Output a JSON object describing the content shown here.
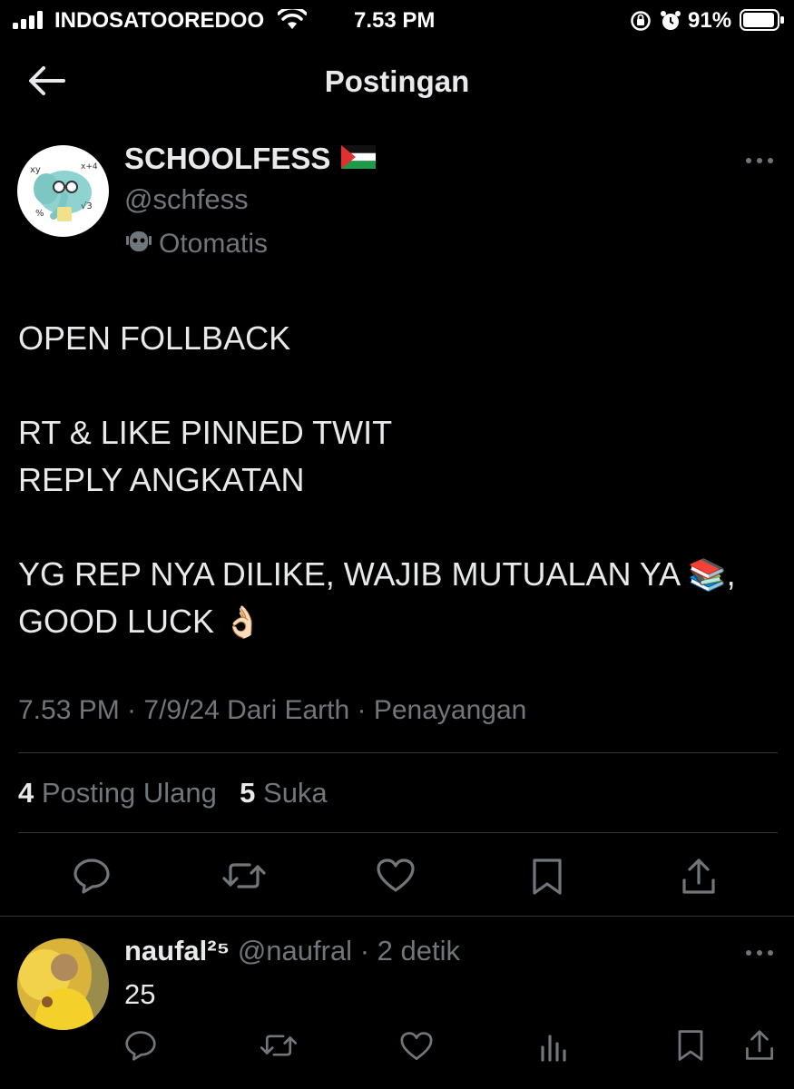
{
  "status_bar": {
    "carrier": "INDOSATOOREDOO",
    "time": "7.53 PM",
    "battery": "91%",
    "icons": [
      "signal-icon",
      "wifi-icon",
      "orientation-lock-icon",
      "alarm-icon",
      "battery-icon"
    ]
  },
  "header": {
    "title": "Postingan",
    "back_icon": "arrow-left-icon"
  },
  "post": {
    "author_name": "SCHOOLFESS",
    "author_handle": "@schfess",
    "automated_label": "Otomatis",
    "lines": [
      "OPEN FOLLBACK",
      "RT & LIKE PINNED TWIT",
      "REPLY ANGKATAN",
      "YG REP NYA DILIKE, WAJIB MUTUALAN YA",
      ",",
      "GOOD LUCK"
    ],
    "emoji_books": "📚",
    "emoji_ok": "👌🏻",
    "meta": "7.53 PM · 7/9/24 Dari Earth · Penayangan",
    "repost_count": "4",
    "repost_label": "Posting Ulang",
    "like_count": "5",
    "like_label": "Suka"
  },
  "reply": {
    "author_name": "naufal²⁵",
    "author_handle": "@naufral",
    "time": "· 2 detik",
    "text": "25"
  },
  "colors": {
    "background": "#000000",
    "text": "#e7e9ea",
    "muted": "#71767b",
    "divider": "#2f3336"
  }
}
